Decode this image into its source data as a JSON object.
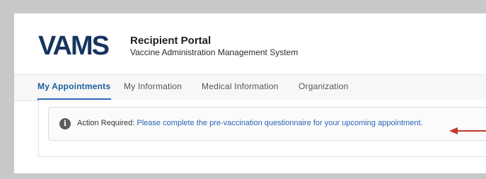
{
  "brand": {
    "logo_text": "VAMS",
    "portal_title": "Recipient Portal",
    "portal_subtitle": "Vaccine Administration Management System"
  },
  "nav": {
    "tabs": [
      {
        "label": "My Appointments",
        "active": true
      },
      {
        "label": "My Information",
        "active": false
      },
      {
        "label": "Medical Information",
        "active": false
      },
      {
        "label": "Organization",
        "active": false
      }
    ]
  },
  "alert": {
    "icon": "info-icon",
    "prefix": "Action Required:",
    "link_text": "Please complete the pre-vaccination questionnaire for your upcoming appointment."
  },
  "colors": {
    "brand_navy": "#16355f",
    "accent_blue": "#2a6eb2",
    "link_blue": "#2b63b8",
    "arrow_red": "#c0392b"
  }
}
